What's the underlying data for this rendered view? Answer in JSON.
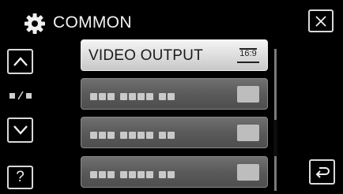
{
  "header": {
    "title": "COMMON",
    "icon": "gear-icon"
  },
  "nav": {
    "up_icon": "chevron-up-icon",
    "down_icon": "chevron-down-icon",
    "close_icon": "close-icon",
    "back_icon": "return-arrow-icon",
    "help_label": "?"
  },
  "menu": {
    "items": [
      {
        "label": "VIDEO OUTPUT",
        "value": "16:9",
        "active": true
      }
    ]
  },
  "colors": {
    "background": "#000000",
    "item_active": "#e6e6e6",
    "item_inactive": "#5f5f5f"
  }
}
